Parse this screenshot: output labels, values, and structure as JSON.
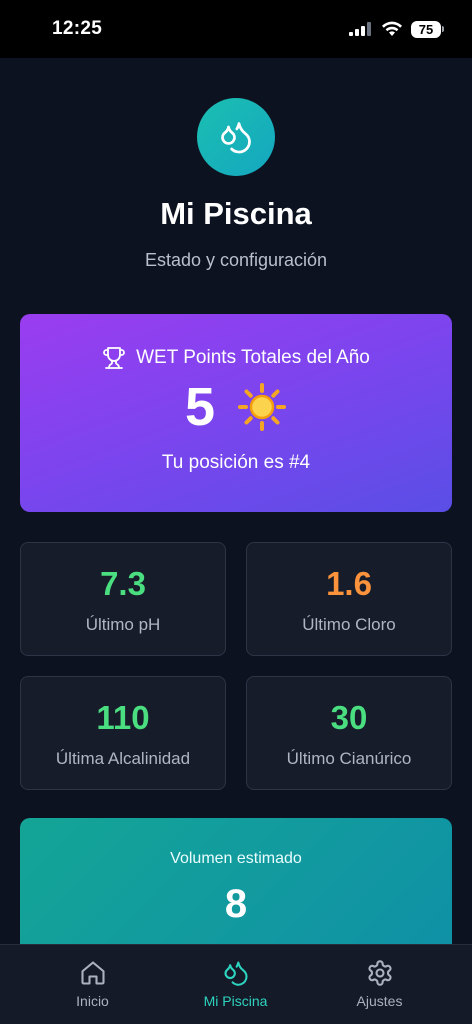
{
  "status_bar": {
    "time": "12:25",
    "battery": "75"
  },
  "header": {
    "logo_icon": "water-drops-icon",
    "title": "Mi Piscina",
    "subtitle": "Estado y configuración"
  },
  "points_card": {
    "icon": "trophy-icon",
    "title": "WET Points Totales del Año",
    "value": "5",
    "value_icon": "sun-icon",
    "rank_text": "Tu posición es #4"
  },
  "stats": [
    {
      "value": "7.3",
      "label": "Último pH",
      "color": "#4ade80"
    },
    {
      "value": "1.6",
      "label": "Último Cloro",
      "color": "#fb923c"
    },
    {
      "value": "110",
      "label": "Última Alcalinidad",
      "color": "#4ade80"
    },
    {
      "value": "30",
      "label": "Último Cianúrico",
      "color": "#4ade80"
    }
  ],
  "volume_card": {
    "label": "Volumen estimado",
    "value": "8"
  },
  "tabbar": {
    "active_color": "#2dd4bf",
    "items": [
      {
        "label": "Inicio",
        "icon": "home-icon"
      },
      {
        "label": "Mi Piscina",
        "icon": "water-drops-icon"
      },
      {
        "label": "Ajustes",
        "icon": "gear-icon"
      }
    ]
  }
}
